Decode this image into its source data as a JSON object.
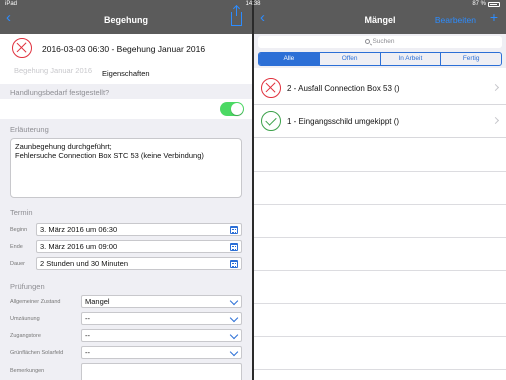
{
  "status_bar": {
    "device": "iPad",
    "time": "14:38",
    "battery": "87 %"
  },
  "left": {
    "nav": {
      "back": "‹",
      "title": "Begehung"
    },
    "header": {
      "title": "2016-03-03 06:30 - Begehung Januar 2016",
      "ghost_title": "Begehung Januar 2016",
      "properties": "Eigenschaften"
    },
    "handlungsbedarf": {
      "label": "Handlungsbedarf festgestellt?",
      "value": true
    },
    "erlaeuterung": {
      "label": "Erläuterung",
      "text": "Zaunbegehung durchgeführt;\nFehlersuche Connection Box STC 53 (keine Verbindung)"
    },
    "termin": {
      "label": "Termin",
      "fields": [
        {
          "label": "Beginn",
          "value": "3. März 2016 um 06:30"
        },
        {
          "label": "Ende",
          "value": "3. März 2016 um 09:00"
        },
        {
          "label": "Dauer",
          "value": "2 Stunden und 30 Minuten"
        }
      ]
    },
    "pruefungen": {
      "label": "Prüfungen",
      "items": [
        {
          "label": "Allgemeiner Zustand",
          "value": "Mangel"
        },
        {
          "label": "Umzäunung",
          "value": "--"
        },
        {
          "label": "Zugangstore",
          "value": "--"
        },
        {
          "label": "Grünflächen Solarfeld",
          "value": "--"
        }
      ],
      "remarks_label": "Bemerkungen"
    }
  },
  "right": {
    "nav": {
      "back": "‹",
      "title": "Mängel",
      "edit": "Bearbeiten",
      "add": "+"
    },
    "search": {
      "placeholder": "Suchen"
    },
    "segments": [
      "Alle",
      "Offen",
      "In Arbeit",
      "Fertig"
    ],
    "active_segment": "Alle",
    "items": [
      {
        "status": "open",
        "label": "2 - Ausfall Connection Box 53 ()"
      },
      {
        "status": "done",
        "label": "1 - Eingangsschild umgekippt ()"
      }
    ]
  },
  "colors": {
    "accent": "#2c6fd6",
    "open": "#e0303d",
    "done": "#3ca14a",
    "toggle_on": "#4cd964"
  }
}
